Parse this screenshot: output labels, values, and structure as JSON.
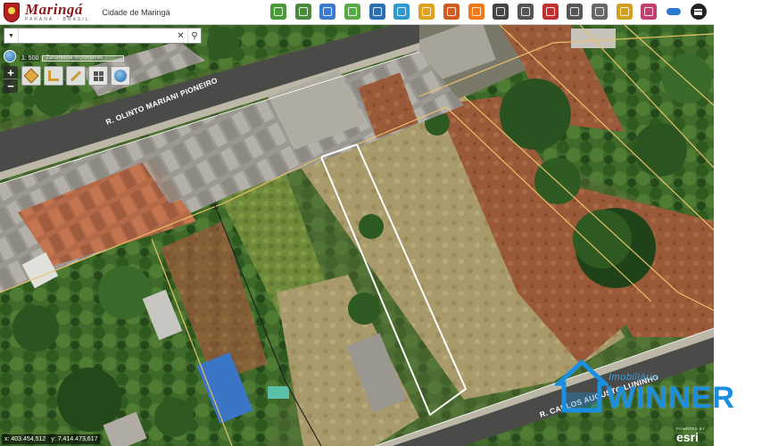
{
  "header": {
    "logo": {
      "name": "Maringá",
      "tagline": "PARANÁ · BRASIL"
    },
    "title": "Cidade de Maringá"
  },
  "toolbar": {
    "tools": [
      {
        "name": "checkbox-layers-icon",
        "color": "#4a9a3a"
      },
      {
        "name": "cube-3d-icon",
        "color": "#4b8a3c"
      },
      {
        "name": "satellite-map-icon",
        "color": "#3a7ad0"
      },
      {
        "name": "basemap-icon",
        "color": "#5aa845"
      },
      {
        "name": "zoom-search-icon",
        "color": "#2c6fb0"
      },
      {
        "name": "globe-icon",
        "color": "#2e9ad0"
      },
      {
        "name": "aerial-photo-icon",
        "color": "#e0a020"
      },
      {
        "name": "color-chart-icon",
        "color": "#d05a20"
      },
      {
        "name": "compass-icon",
        "color": "#f07a1a"
      },
      {
        "name": "pipes-icon",
        "color": "#444444"
      },
      {
        "name": "tools-icon",
        "color": "#555555"
      },
      {
        "name": "location-pin-icon",
        "color": "#c03030"
      },
      {
        "name": "list-icon",
        "color": "#555555"
      },
      {
        "name": "measure-pencil-icon",
        "color": "#666666"
      },
      {
        "name": "ruler-triangle-icon",
        "color": "#d0a020"
      },
      {
        "name": "people-icon",
        "color": "#c04070"
      },
      {
        "name": "cloud-icon",
        "color": "#2a7ad0"
      },
      {
        "name": "main-menu-icon",
        "color": "#222222"
      }
    ]
  },
  "search": {
    "value": "",
    "placeholder": ""
  },
  "scale": {
    "label": "1: 500",
    "bar_label": "Zarameuse mcrometres"
  },
  "coordinates": {
    "x": "x: 403.454,512",
    "y": "y: 7.414.473,617"
  },
  "streets": {
    "upper": "R. OLINTO MARIANI PIONEIRO",
    "lower": "R. CARLOS AUGUSTO LUNINHO"
  },
  "watermark": {
    "small": "Imobiliária",
    "big": "WINNER"
  },
  "attribution": {
    "small": "POWERED BY",
    "big": "esri"
  },
  "colors": {
    "accent": "#1a8fe0",
    "parcel_line": "#ffffff",
    "lot_outline": "#e8c26a"
  }
}
